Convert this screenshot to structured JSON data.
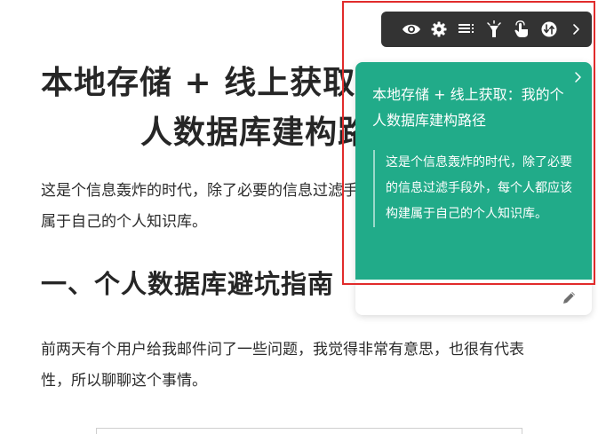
{
  "article": {
    "title_line1": "本地存储 + 线上获取：我的个",
    "title_line2": "人数据库建构路径",
    "paragraph1": "这是个信息轰炸的时代，除了必要的信息过滤手段外，每个人都应该构建属于自己的个人知识库。",
    "heading2": "一、个人数据库避坑指南",
    "paragraph2": "前两天有个用户给我邮件问了一些问题，我觉得非常有意思，也很有代表性，所以聊聊这个事情。"
  },
  "toolbar": {
    "icons": [
      "eye-icon",
      "gear-icon",
      "list-icon",
      "flashlight-icon",
      "hand-pointer-icon",
      "swap-circle-icon",
      "chevron-right-icon"
    ]
  },
  "card": {
    "title": "本地存储 + 线上获取：我的个人数据库建构路径",
    "quote": "这是个信息轰炸的时代，除了必要的信息过滤手段外，每个人都应该构建属于自己的个人知识库。",
    "background_color": "#21ab89"
  },
  "colors": {
    "toolbar_bg": "#333333",
    "highlight_border": "#e12b2b"
  }
}
